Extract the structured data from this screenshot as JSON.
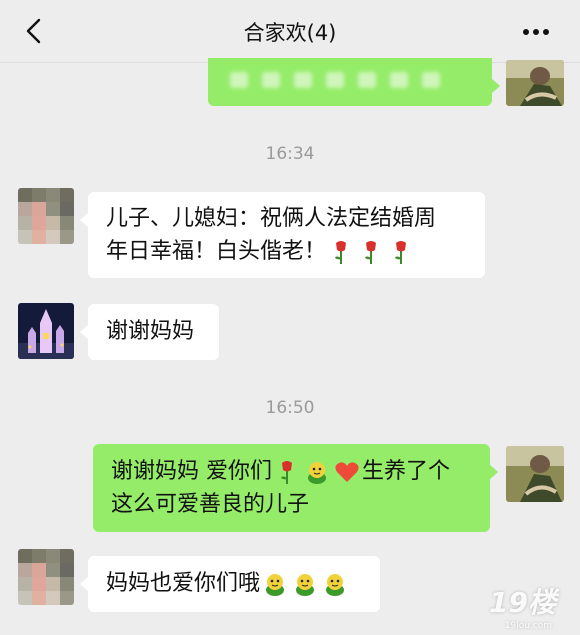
{
  "header": {
    "title": "合家欢(4)",
    "back_icon": "chevron-left-icon",
    "more_icon": "more-dots-icon"
  },
  "messages": {
    "time_1": "16:34",
    "msg_1": {
      "line_1": "儿子、儿媳妇：祝俩人法定结婚周",
      "line_2": "年日幸福！白头偕老！",
      "emoji": "rose-icon"
    },
    "msg_2": {
      "text": "谢谢妈妈"
    },
    "time_2": "16:50",
    "msg_3": {
      "line_1_a": "谢谢妈妈 爱你们",
      "line_1_b": "生养了个",
      "line_2": "这么可爱善良的儿子",
      "emojis": [
        "rose-icon",
        "frog-icon",
        "heart-icon"
      ]
    },
    "msg_4": {
      "text": "妈妈也爱你们哦",
      "emojis": [
        "frog-icon",
        "frog-icon",
        "frog-icon"
      ]
    }
  },
  "watermark": {
    "text": "19楼",
    "sub": "19lou.com"
  },
  "colors": {
    "background": "#ededed",
    "sent_bubble": "#95ec69",
    "received_bubble": "#ffffff",
    "timestamp": "#9a9a9a"
  }
}
